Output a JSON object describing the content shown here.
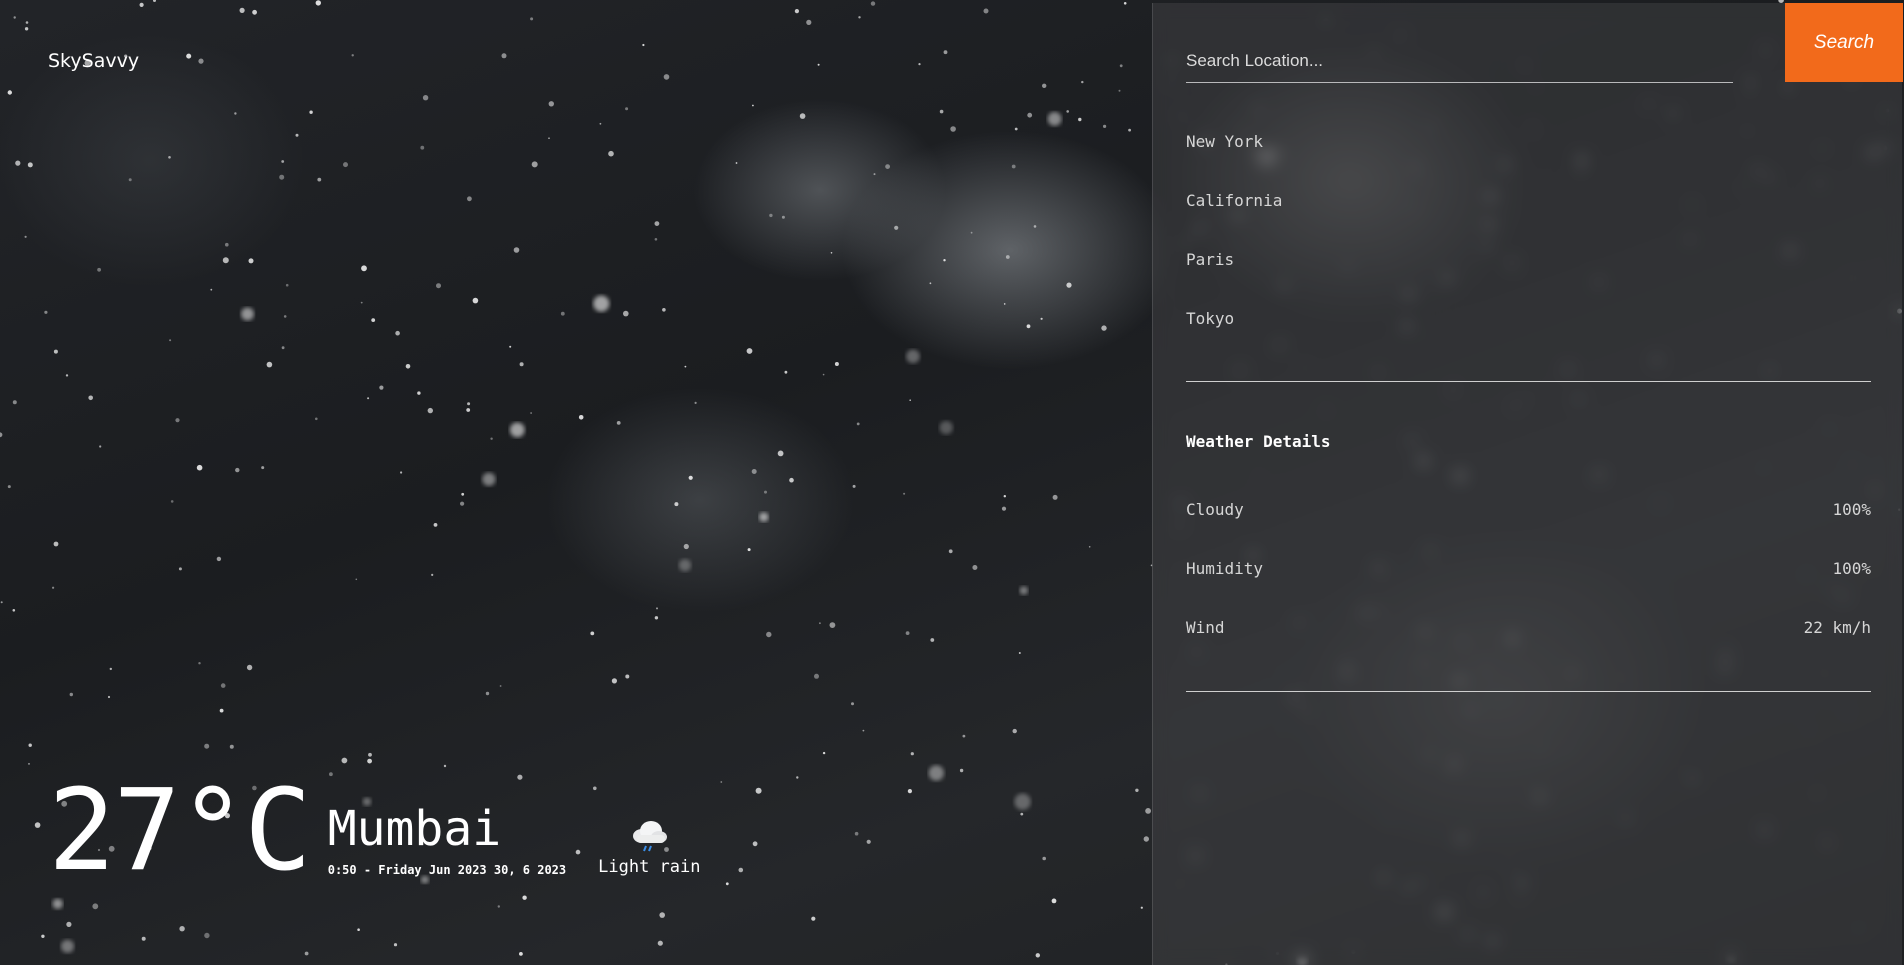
{
  "brand": {
    "name": "SkySavvy"
  },
  "current": {
    "temperature": "27°C",
    "city": "Mumbai",
    "datetime": "0:50 - Friday Jun 2023 30, 6 2023",
    "condition": "Light rain",
    "condition_icon": "rain-cloud-icon"
  },
  "search": {
    "placeholder": "Search Location...",
    "value": "",
    "button_label": "Search"
  },
  "locations": [
    "New York",
    "California",
    "Paris",
    "Tokyo"
  ],
  "details": {
    "title": "Weather Details",
    "items": [
      {
        "label": "Cloudy",
        "value": "100%"
      },
      {
        "label": "Humidity",
        "value": "100%"
      },
      {
        "label": "Wind",
        "value": "22 km/h"
      }
    ]
  },
  "colors": {
    "accent": "#f26a1b",
    "text": "#ffffff",
    "muted_text": "#d6d6d6"
  }
}
